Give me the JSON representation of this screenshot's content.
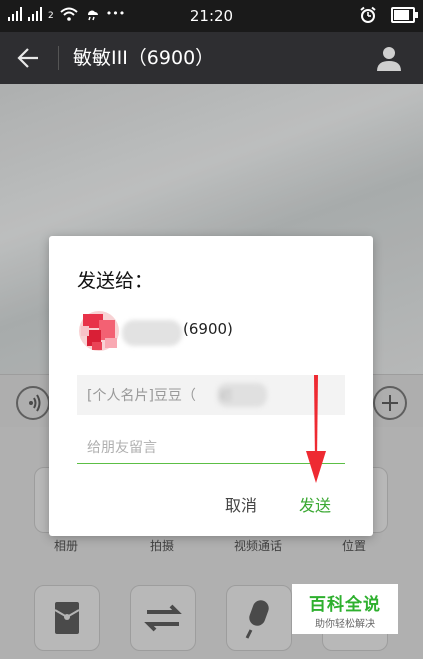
{
  "status_bar": {
    "network_badge": "2",
    "more_dots": "•••",
    "time": "21:20",
    "battery_level": 0.85
  },
  "header": {
    "title": "敏敏III（6900）",
    "back_icon": "arrow-left-icon",
    "profile_icon": "person-icon"
  },
  "dialog": {
    "title": "发送给：",
    "recipient_suffix": "(6900)",
    "card_prefix": "[个人名片]豆豆（",
    "card_blur_char": "初",
    "message_placeholder": "给朋友留言",
    "cancel_label": "取消",
    "send_label": "发送"
  },
  "panel": {
    "row1": [
      "相册",
      "拍摄",
      "视频通话",
      "位置"
    ],
    "row2_icons": [
      "red-envelope-icon",
      "transfer-icon",
      "microphone-icon",
      ""
    ]
  },
  "colors": {
    "accent_green": "#3aa832",
    "header_bg": "#2e2e31",
    "annotation_red": "#ee2a32"
  },
  "watermark": {
    "title": "百科全说",
    "subtitle": "助你轻松解决"
  }
}
